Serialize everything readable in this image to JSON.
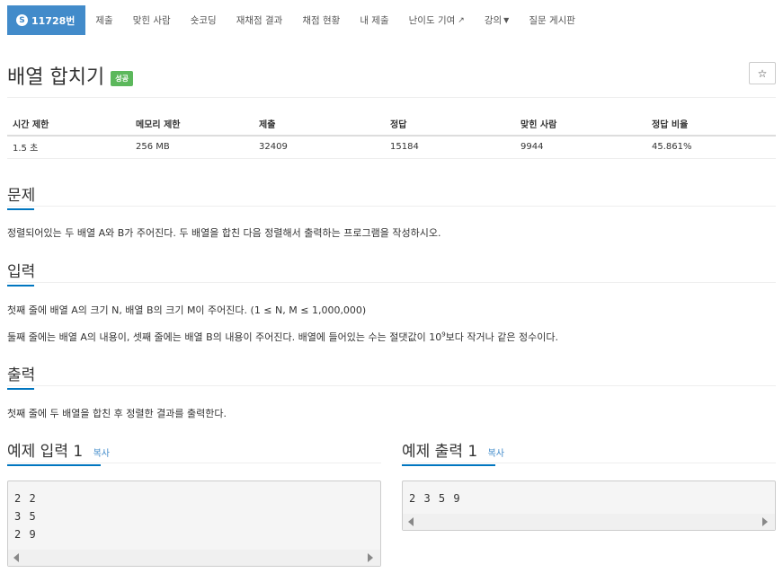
{
  "nav": {
    "problem_number": "11728번",
    "problem_badge": "S",
    "items": [
      "제출",
      "맞힌 사람",
      "숏코딩",
      "재채점 결과",
      "채점 현황",
      "내 제출",
      "난이도 기여",
      "강의",
      "질문 게시판"
    ]
  },
  "problem": {
    "title": "배열 합치기",
    "status": "성공",
    "star": "☆"
  },
  "info_table": {
    "headers": [
      "시간 제한",
      "메모리 제한",
      "제출",
      "정답",
      "맞힌 사람",
      "정답 비율"
    ],
    "values": [
      "1.5 초",
      "256 MB",
      "32409",
      "15184",
      "9944",
      "45.861%"
    ]
  },
  "sections": {
    "description_title": "문제",
    "description": "정렬되어있는 두 배열 A와 B가 주어진다. 두 배열을 합친 다음 정렬해서 출력하는 프로그램을 작성하시오.",
    "input_title": "입력",
    "input_line1": "첫째 줄에 배열 A의 크기 N, 배열 B의 크기 M이 주어진다. (1 ≤ N, M ≤ 1,000,000)",
    "input_line2_pre": "둘째 줄에는 배열 A의 내용이, 셋째 줄에는 배열 B의 내용이 주어진다. 배열에 들어있는 수는 절댓값이 10",
    "input_line2_sup": "9",
    "input_line2_post": "보다 작거나 같은 정수이다.",
    "output_title": "출력",
    "output": "첫째 줄에 두 배열을 합친 후 정렬한 결과를 출력한다."
  },
  "samples": {
    "input_title": "예제 입력 1",
    "input_copy": "복사",
    "input_text": "2 2\n3 5\n2 9",
    "output_title": "예제 출력 1",
    "output_copy": "복사",
    "output_text": "2 3 5 9"
  }
}
